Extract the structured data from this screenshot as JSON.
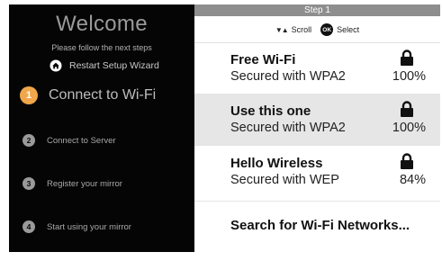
{
  "sidebar": {
    "title": "Welcome",
    "subtitle": "Please follow the next steps",
    "restart_label": "Restart Setup Wizard",
    "restart_icon": "home-icon",
    "accent_color": "#f0a64a",
    "steps": [
      {
        "number": "1",
        "label": "Connect to Wi-Fi",
        "active": true
      },
      {
        "number": "2",
        "label": "Connect to Server",
        "active": false
      },
      {
        "number": "3",
        "label": "Register your mirror",
        "active": false
      },
      {
        "number": "4",
        "label": "Start using your mirror",
        "active": false
      }
    ]
  },
  "main": {
    "step_header": "Step 1",
    "hint": {
      "scroll_glyph": "▼▲",
      "scroll_label": "Scroll",
      "ok_glyph": "OK",
      "select_label": "Select"
    },
    "networks": [
      {
        "name": "Free Wi-Fi",
        "security": "Secured with WPA2",
        "signal": "100%",
        "locked": true,
        "selected": false
      },
      {
        "name": "Use this one",
        "security": "Secured with WPA2",
        "signal": "100%",
        "locked": true,
        "selected": true
      },
      {
        "name": "Hello Wireless",
        "security": "Secured with WEP",
        "signal": "84%",
        "locked": true,
        "selected": false
      }
    ],
    "search_label": "Search for Wi-Fi Networks..."
  }
}
